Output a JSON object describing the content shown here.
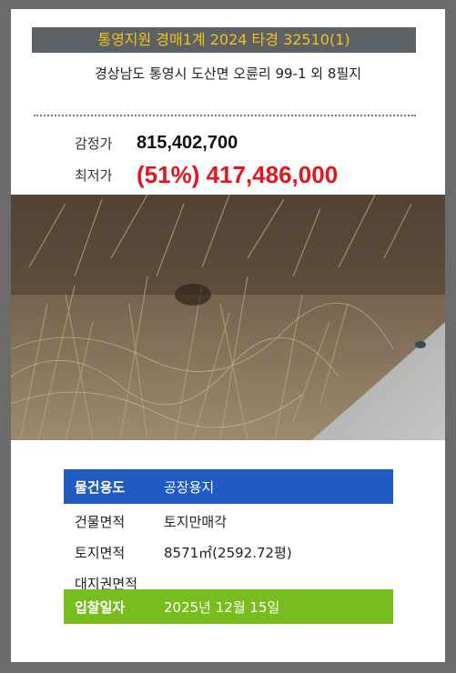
{
  "header": {
    "title": "통영지원 경매1계 2024 타경 32510(1)"
  },
  "address": "경상남도 통영시 도산면 오륜리 99-1 외 8필지",
  "prices": {
    "appraised_label": "감정가",
    "appraised_value": "815,402,700",
    "minimum_label": "최저가",
    "minimum_value": "(51%) 417,486,000"
  },
  "photo": {
    "description_icon": "land-photo"
  },
  "details": {
    "usage_label": "물건용도",
    "usage_value": "공장용지",
    "building_area_label": "건물면적",
    "building_area_value": "토지만매각",
    "land_area_label": "토지면적",
    "land_area_value": "8571㎡(2592.72평)",
    "land_right_label": "대지권면적",
    "land_right_value": "",
    "bid_date_label": "입찰일자",
    "bid_date_value": "2025년 12월 15일"
  },
  "colors": {
    "title_bg": "#5c6166",
    "title_text": "#f0c419",
    "minimum_price": "#e8141c",
    "usage_row": "#1f5bc0",
    "bid_row": "#78bd1e"
  }
}
